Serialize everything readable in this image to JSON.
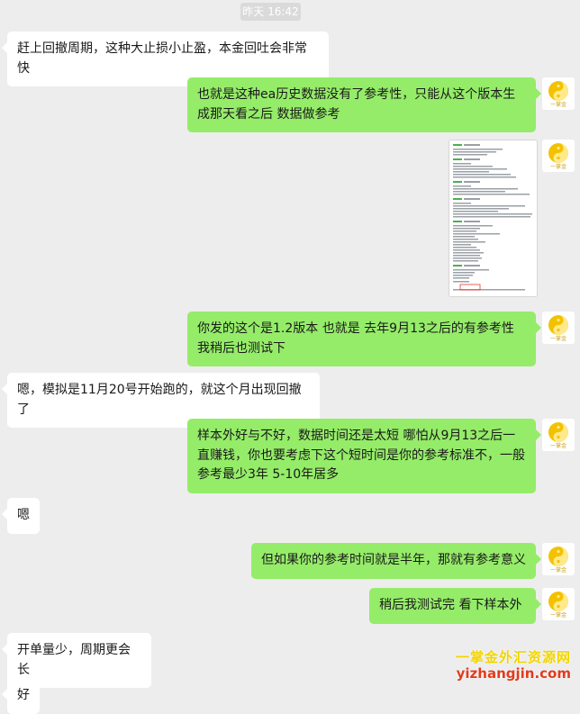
{
  "chat": {
    "timestamp": "昨天 16:42",
    "messages": [
      {
        "side": "left",
        "text": "赶上回撤周期，这种大止损小止盈，本金回吐会非常快"
      },
      {
        "side": "right",
        "text": "也就是这种ea历史数据没有了参考性，只能从这个版本生成那天看之后 数据做参考"
      },
      {
        "side": "right",
        "type": "image"
      },
      {
        "side": "right",
        "text": "你发的这个是1.2版本 也就是 去年9月13之后的有参考性 我稍后也测试下"
      },
      {
        "side": "left",
        "text": "嗯，模拟是11月20号开始跑的，就这个月出现回撤了"
      },
      {
        "side": "right",
        "text": "样本外好与不好，数据时间还是太短 哪怕从9月13之后一直赚钱，你也要考虑下这个短时间是你的参考标准不，一般参考最少3年 5-10年居多"
      },
      {
        "side": "left",
        "text": "嗯"
      },
      {
        "side": "right",
        "text": "但如果你的参考时间就是半年，那就有参考意义"
      },
      {
        "side": "right",
        "text": "稍后我测试完  看下样本外"
      },
      {
        "side": "left",
        "text": "开单量少，周期更会长"
      },
      {
        "side": "left",
        "text": "好"
      }
    ]
  },
  "avatar": {
    "label": "一掌金",
    "icon": "yin-yang-logo-icon"
  },
  "watermark": {
    "line1": "一掌金外汇资源网",
    "line2": "yizhangjin.com"
  },
  "colors": {
    "background": "#ededed",
    "bubble_self": "#95ec69",
    "bubble_other": "#ffffff",
    "avatar_accent": "#f2c200"
  }
}
